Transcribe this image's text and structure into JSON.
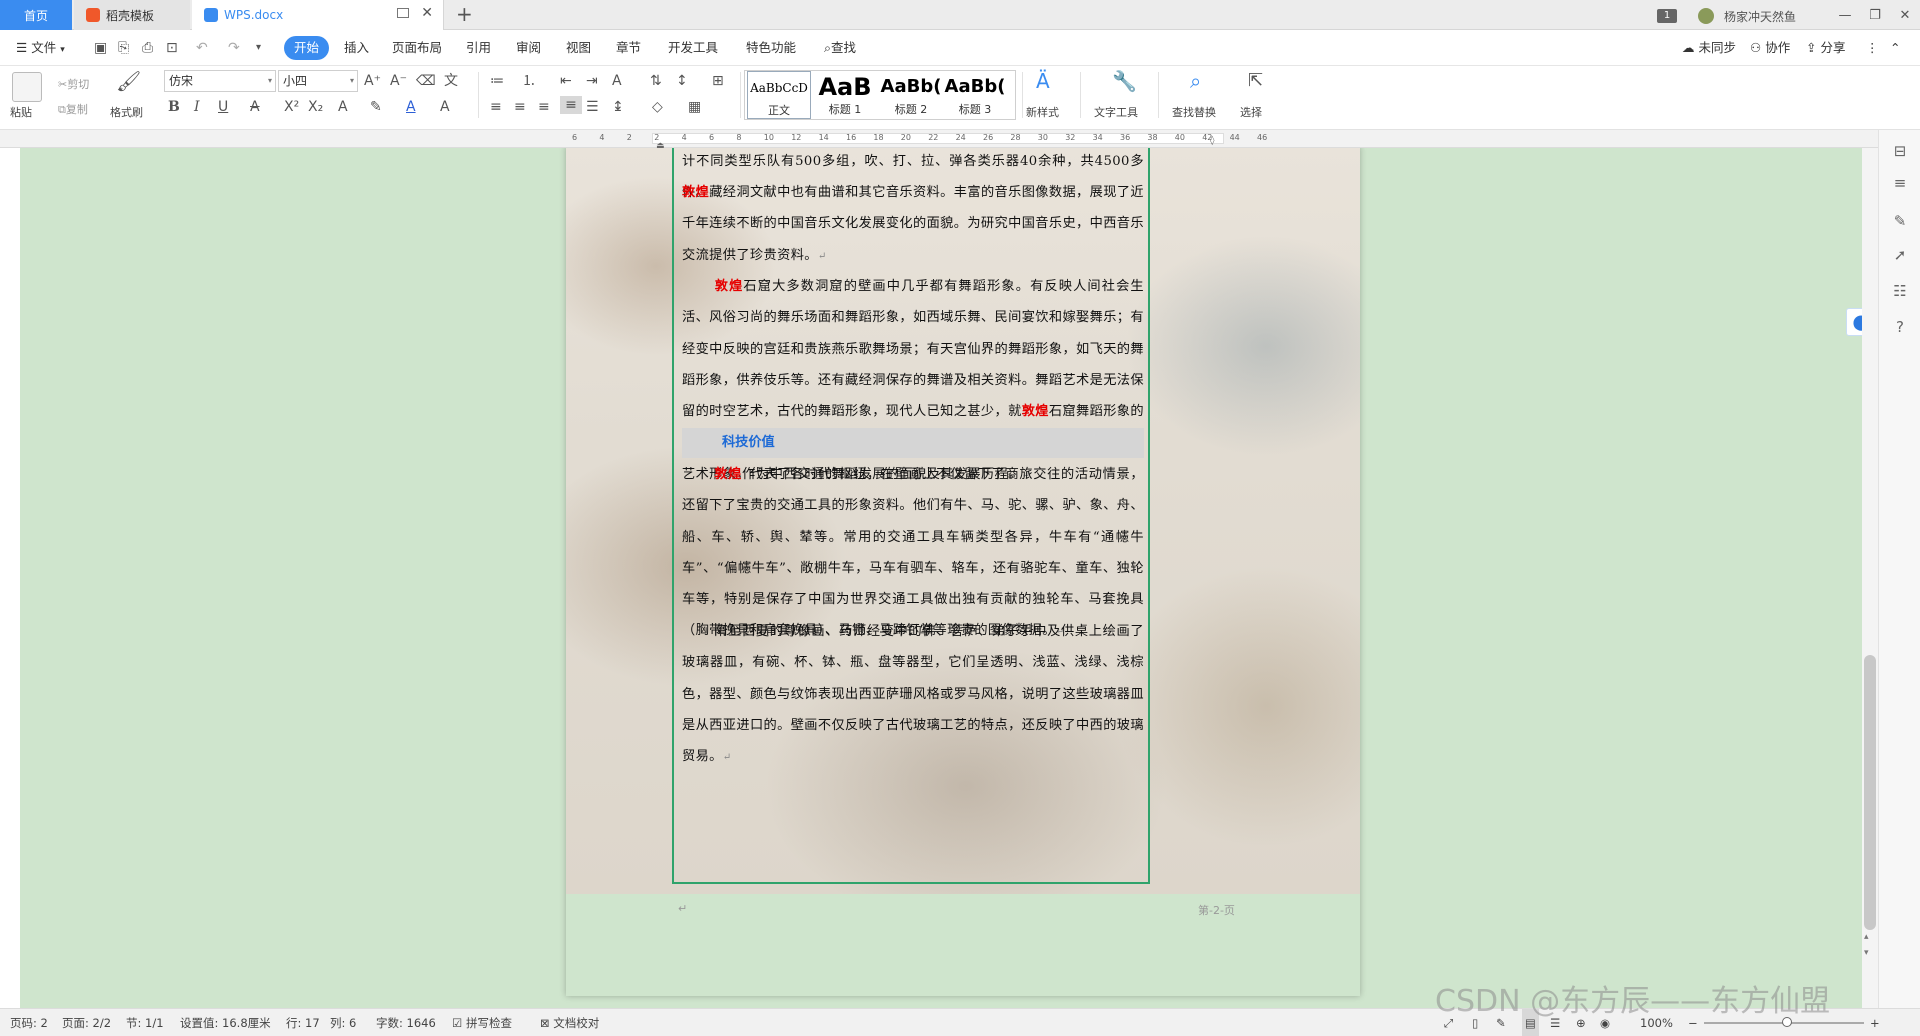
{
  "titlebar": {
    "tabs": [
      {
        "label": "首页"
      },
      {
        "label": "稻壳模板"
      },
      {
        "label": "WPS.docx"
      }
    ],
    "new_tab": "+",
    "page_badge": "1",
    "user_name": "杨家冲天然鱼",
    "minimize": "—",
    "restore": "❐",
    "close": "✕"
  },
  "menubar": {
    "file": "文件",
    "items": [
      "开始",
      "插入",
      "页面布局",
      "引用",
      "审阅",
      "视图",
      "章节",
      "开发工具",
      "特色功能"
    ],
    "search": "查找",
    "sync": "未同步",
    "collab": "协作",
    "share": "分享"
  },
  "ribbon": {
    "paste": "粘贴",
    "cut": "剪切",
    "copy": "复制",
    "format_painter": "格式刷",
    "font_name": "仿宋",
    "font_size": "小四",
    "styles": [
      {
        "preview": "AaBbCcD",
        "name": "正文"
      },
      {
        "preview": "AaB",
        "name": "标题 1"
      },
      {
        "preview": "AaBb(",
        "name": "标题 2"
      },
      {
        "preview": "AaBb(",
        "name": "标题 3"
      }
    ],
    "new_style": "新样式",
    "text_tools": "文字工具",
    "find_replace": "查找替换",
    "select": "选择"
  },
  "ruler": {
    "ticks": [
      "6",
      "4",
      "2",
      "2",
      "4",
      "6",
      "8",
      "10",
      "12",
      "14",
      "16",
      "18",
      "20",
      "22",
      "24",
      "26",
      "28",
      "30",
      "32",
      "34",
      "36",
      "38",
      "40",
      "42",
      "44",
      "46"
    ]
  },
  "document": {
    "para1": "计不同类型乐队有500多组，吹、打、拉、弹各类乐器40余种，共4500多件。",
    "para2_red": "敦煌",
    "para2": "藏经洞文献中也有曲谱和其它音乐资料。丰富的音乐图像数据，展现了近千年连续不断的中国音乐文化发展变化的面貌。为研究中国音乐史，中西音乐交流提供了珍贵资料。",
    "para3_red": "敦煌",
    "para3a": "石窟大多数洞窟的壁画中几乎都有舞蹈形象。有反映人间社会生活、风俗习尚的舞乐场面和舞蹈形象，如西域乐舞、民间宴饮和嫁娶舞乐；有经变中反映的宫廷和贵族燕乐歌舞场景；有天宫仙界的舞蹈形象，如飞天的舞蹈形象，供养伎乐等。还有藏经洞保存的舞谱及相关资料。舞蹈艺术是无法保留的时空艺术，古代的舞蹈形象，现代人已知之甚少，就",
    "para3_red2": "敦煌",
    "para3b": "石窟舞蹈形象的珍藏而言，堪称舞蹈艺术的博物馆，保存了无数高超的舞蹈技巧和完美的舞蹈艺术形象，代表了各时代舞蹈发展的面貌及其发展历程。",
    "heading": "科技价值",
    "para4_red": "敦煌",
    "para4": "作为中西交通的枢纽，在壁画上不仅留下了商旅交往的活动情景，还留下了宝贵的交通工具的形象资料。他们有牛、马、驼、骡、驴、象、舟、船、车、轿、舆、辇等。常用的交通工具车辆类型各异，牛车有“通幰牛车”、“偏幰牛车”、敞棚牛车，马车有驷车、辂车，还有骆驼车、童车、独轮车等，特别是保存了中国为世界交通工具做出独有贡献的独轮车、马套挽具（胸带挽具和肩套挽具）、马镫、马蹄钉掌等珍贵的图像数据。",
    "para5": "隋至西夏的尊像画、药师经变中的佛、菩萨、弟子手中及供桌上绘画了玻璃器皿，有碗、杯、钵、瓶、盘等器型，它们呈透明、浅蓝、浅绿、浅棕色，器型、颜色与纹饰表现出西亚萨珊风格或罗马风格，说明了这些玻璃器皿是从西亚进口的。壁画不仅反映了古代玻璃工艺的特点，还反映了中西的玻璃贸易。",
    "para_mark": "↵",
    "page_label": "第-2-页"
  },
  "statusbar": {
    "page_code": "页码: 2",
    "pages": "页面: 2/2",
    "section": "节: 1/1",
    "setting": "设置值: 16.8厘米",
    "row": "行: 17",
    "col": "列: 6",
    "words": "字数: 1646",
    "spell": "拼写检查",
    "proof": "文档校对",
    "zoom": "100%",
    "minus": "−",
    "plus": "+"
  },
  "watermark": "CSDN @东方辰——东方仙盟",
  "colors": {
    "accent": "#3a8cf0",
    "page_bg": "#cfe5cd",
    "frame": "#2fa36b",
    "red_text": "#e60000",
    "heading_blue": "#1d6ad6"
  }
}
